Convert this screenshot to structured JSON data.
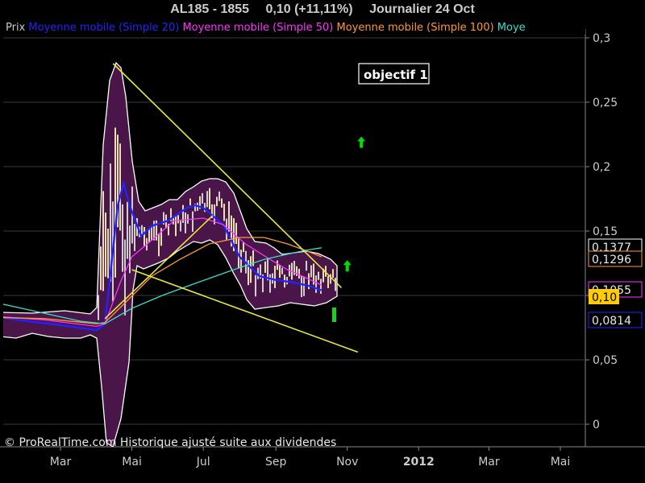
{
  "header": {
    "symbol": "AL185 - 1855",
    "quote": "0,10 (+11,11%)",
    "period": "Journalier  24 Oct"
  },
  "legend": [
    {
      "label": "Prix",
      "color": "#c8c8c8"
    },
    {
      "label": "Moyenne mobile (Simple 20)",
      "color": "#2222ff"
    },
    {
      "label": "Moyenne mobile (Simple 50)",
      "color": "#ff33ff"
    },
    {
      "label": "Moyenne mobile (Simple 100)",
      "color": "#ff9933"
    },
    {
      "label": "Moye",
      "color": "#33e0cc"
    }
  ],
  "annotation": {
    "text": "objectif 1"
  },
  "copyright": "© ProRealTime.com Historique ajusté suite aux dividendes",
  "chart_data": {
    "type": "line",
    "y_axis": {
      "ticks": [
        "0,3",
        "0,25",
        "0,2",
        "0,15",
        "0,1",
        "0,05",
        "0"
      ],
      "tick_values": [
        0.3,
        0.25,
        0.2,
        0.15,
        0.1,
        0.05,
        0
      ],
      "ylim": [
        0,
        0.3
      ],
      "position": "right"
    },
    "x_axis": {
      "labels": [
        "Mar",
        "Mai",
        "Jul",
        "Sep",
        "Nov",
        "2012",
        "Mar",
        "Mai"
      ],
      "label_dates": [
        "2011-03",
        "2011-05",
        "2011-07",
        "2011-09",
        "2011-11",
        "2012-01",
        "2012-03",
        "2012-05"
      ],
      "bold_labels": [
        "2012"
      ]
    },
    "price_labels": [
      {
        "text": "0,1377",
        "value": 0.1377,
        "style": "box",
        "color": "#33e0cc"
      },
      {
        "text": "0,1296",
        "value": 0.1296,
        "style": "box",
        "color": "#ff9933"
      },
      {
        "text": "0,1055",
        "value": 0.1055,
        "style": "box",
        "color": "#ff33ff"
      },
      {
        "text": "0,10",
        "value": 0.1,
        "style": "highlight",
        "color": "#ffcc00"
      },
      {
        "text": "0,0814",
        "value": 0.0814,
        "style": "box",
        "color": "#2222ff"
      }
    ],
    "series": [
      {
        "name": "Moyenne mobile (Simple 20)",
        "color": "#2222ff",
        "points": [
          [
            "2011-01-15",
            0.084
          ],
          [
            "2011-02-15",
            0.08
          ],
          [
            "2011-03-15",
            0.077
          ],
          [
            "2011-04-15",
            0.073
          ],
          [
            "2011-04-22",
            0.078
          ],
          [
            "2011-05-03",
            0.17
          ],
          [
            "2011-05-08",
            0.187
          ],
          [
            "2011-05-13",
            0.17
          ],
          [
            "2011-05-23",
            0.146
          ],
          [
            "2011-06-01",
            0.154
          ],
          [
            "2011-06-15",
            0.158
          ],
          [
            "2011-07-01",
            0.168
          ],
          [
            "2011-07-08",
            0.17
          ],
          [
            "2011-07-15",
            0.168
          ],
          [
            "2011-08-01",
            0.155
          ],
          [
            "2011-08-15",
            0.13
          ],
          [
            "2011-09-01",
            0.115
          ],
          [
            "2011-09-15",
            0.112
          ],
          [
            "2011-10-01",
            0.11
          ],
          [
            "2011-10-15",
            0.107
          ],
          [
            "2011-10-24",
            0.104
          ]
        ]
      },
      {
        "name": "Moyenne mobile (Simple 50)",
        "color": "#ff33ff",
        "points": [
          [
            "2011-01-15",
            0.084
          ],
          [
            "2011-03-01",
            0.081
          ],
          [
            "2011-04-15",
            0.076
          ],
          [
            "2011-04-22",
            0.078
          ],
          [
            "2011-05-05",
            0.11
          ],
          [
            "2011-05-15",
            0.13
          ],
          [
            "2011-06-01",
            0.143
          ],
          [
            "2011-06-20",
            0.158
          ],
          [
            "2011-07-15",
            0.16
          ],
          [
            "2011-08-01",
            0.155
          ],
          [
            "2011-08-20",
            0.14
          ],
          [
            "2011-09-10",
            0.128
          ],
          [
            "2011-09-25",
            0.12
          ],
          [
            "2011-10-10",
            0.114
          ],
          [
            "2011-10-24",
            0.108
          ]
        ]
      },
      {
        "name": "Moyenne mobile (Simple 100)",
        "color": "#ff9933",
        "points": [
          [
            "2011-01-15",
            0.083
          ],
          [
            "2011-03-01",
            0.082
          ],
          [
            "2011-04-15",
            0.078
          ],
          [
            "2011-04-22",
            0.079
          ],
          [
            "2011-05-10",
            0.095
          ],
          [
            "2011-06-01",
            0.115
          ],
          [
            "2011-06-25",
            0.128
          ],
          [
            "2011-07-20",
            0.14
          ],
          [
            "2011-08-15",
            0.145
          ],
          [
            "2011-09-05",
            0.145
          ],
          [
            "2011-09-25",
            0.14
          ],
          [
            "2011-10-10",
            0.135
          ],
          [
            "2011-10-24",
            0.13
          ]
        ]
      },
      {
        "name": "Moye",
        "color": "#33e0cc",
        "points": [
          [
            "2011-01-01",
            0.098
          ],
          [
            "2011-02-15",
            0.089
          ],
          [
            "2011-04-01",
            0.08
          ],
          [
            "2011-04-22",
            0.078
          ],
          [
            "2011-05-15",
            0.09
          ],
          [
            "2011-06-10",
            0.1
          ],
          [
            "2011-07-10",
            0.11
          ],
          [
            "2011-08-10",
            0.12
          ],
          [
            "2011-09-05",
            0.128
          ],
          [
            "2011-09-25",
            0.132
          ],
          [
            "2011-10-10",
            0.135
          ],
          [
            "2011-10-24",
            0.137
          ]
        ]
      }
    ],
    "trendlines": [
      {
        "color": "#e8e83a",
        "from": [
          "2011-04-29",
          0.28
        ],
        "to": [
          "2011-11-10",
          0.106
        ]
      },
      {
        "color": "#e8e83a",
        "from": [
          "2011-05-15",
          0.12
        ],
        "to": [
          "2011-11-24",
          0.056
        ]
      },
      {
        "color": "#e8e83a",
        "from": [
          "2011-04-22",
          0.082
        ],
        "to": [
          "2011-07-23",
          0.162
        ]
      },
      {
        "color": "#e8e83a",
        "from": [
          "2011-12-06",
          0.279
        ],
        "to": [
          "2011-12-20",
          0.279
        ]
      }
    ],
    "arrows": [
      {
        "date": "2011-11-27",
        "value": 0.219,
        "direction": "up",
        "color": "#00dd00"
      },
      {
        "date": "2011-11-15",
        "value": 0.123,
        "direction": "up",
        "color": "#00dd00"
      }
    ],
    "band_color": "#4a1548",
    "grid": true,
    "legend_placement": "top"
  }
}
